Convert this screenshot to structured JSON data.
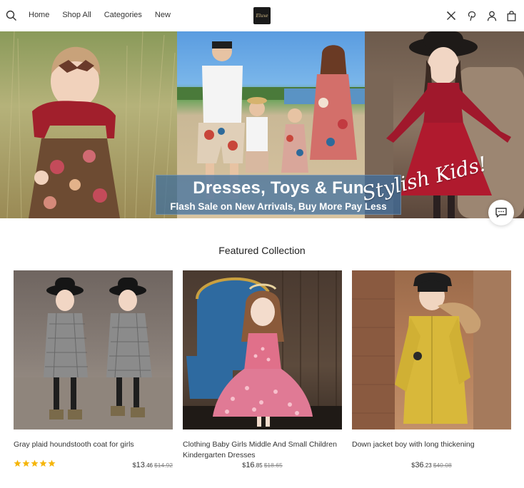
{
  "header": {
    "nav": [
      "Home",
      "Shop All",
      "Categories",
      "New"
    ],
    "logo_text": "Eluxe"
  },
  "hero": {
    "title": "Dresses, Toys & Fun",
    "subtitle": "Flash Sale on New Arrivals, Buy More Pay Less",
    "script_text": "Stylish Kids!"
  },
  "featured": {
    "title": "Featured Collection",
    "products": [
      {
        "name": "Gray plaid houndstooth coat for girls",
        "currency": "$",
        "price_main": "13",
        "price_cents": ".46",
        "price_old": "$14.92",
        "rating": 5
      },
      {
        "name": "Clothing Baby Girls Middle And Small Children Kindergarten Dresses",
        "currency": "$",
        "price_main": "16",
        "price_cents": ".85",
        "price_old": "$18.65",
        "rating": 0
      },
      {
        "name": "Down jacket boy with long thickening",
        "currency": "$",
        "price_main": "36",
        "price_cents": ".23",
        "price_old": "$40.08",
        "rating": 0
      }
    ]
  },
  "colors": {
    "banner_bg": "#3c6ea0",
    "star": "#f5b50a",
    "text": "#222222"
  }
}
